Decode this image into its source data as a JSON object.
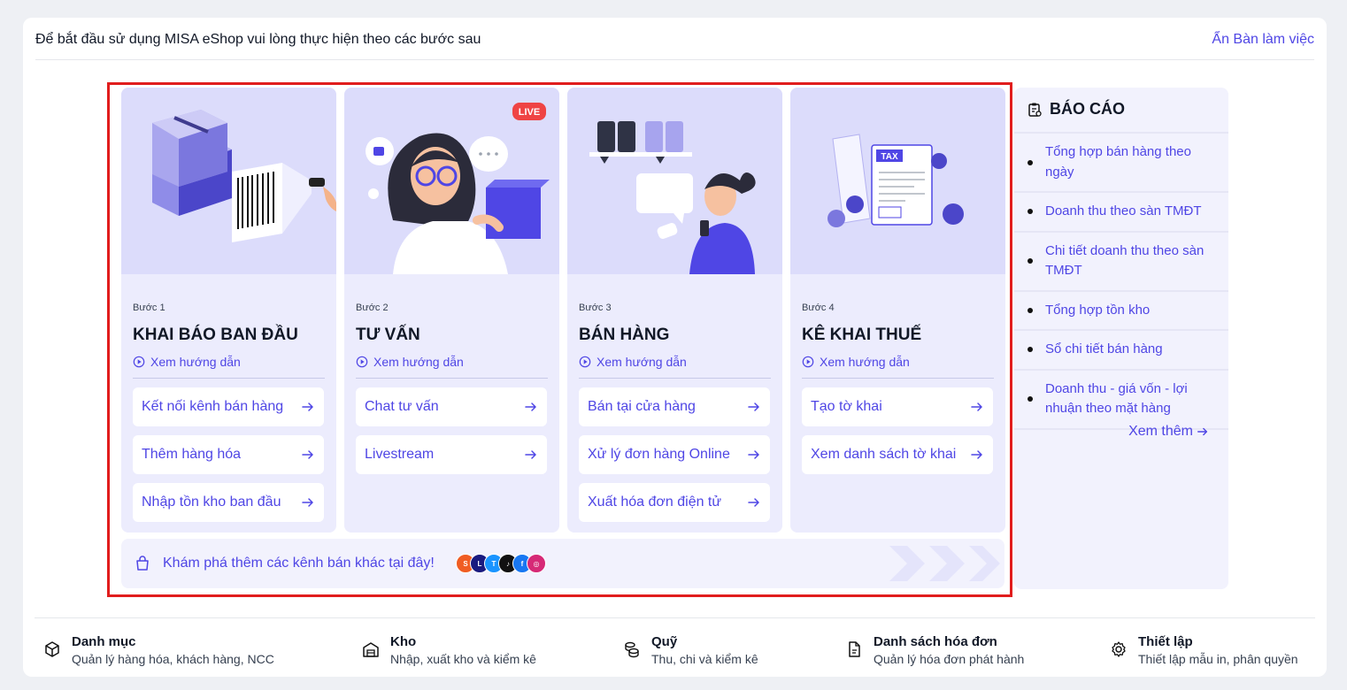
{
  "header": {
    "intro": "Để bắt đầu sử dụng MISA eShop vui lòng thực hiện theo các bước sau",
    "hide_label": "Ẩn Bàn làm việc"
  },
  "steps": [
    {
      "step": "Bước 1",
      "title": "KHAI BÁO BAN ĐẦU",
      "guide": "Xem hướng dẫn",
      "actions": [
        "Kết nối kênh bán hàng",
        "Thêm hàng hóa",
        "Nhập tồn kho ban đầu"
      ]
    },
    {
      "step": "Bước 2",
      "title": "TƯ VẤN",
      "guide": "Xem hướng dẫn",
      "live_badge": "LIVE",
      "actions": [
        "Chat tư vấn",
        "Livestream"
      ]
    },
    {
      "step": "Bước 3",
      "title": "BÁN HÀNG",
      "guide": "Xem hướng dẫn",
      "actions": [
        "Bán tại cửa hàng",
        "Xử lý đơn hàng Online",
        "Xuất hóa đơn điện tử"
      ]
    },
    {
      "step": "Bước 4",
      "title": "KÊ KHAI THUẾ",
      "guide": "Xem hướng dẫn",
      "tax_label": "TAX",
      "actions": [
        "Tạo tờ khai",
        "Xem danh sách tờ khai"
      ]
    }
  ],
  "channels": {
    "text": "Khám phá thêm các kênh bán khác tại đây!",
    "logos": [
      {
        "name": "shopee-icon",
        "color": "#f05d23"
      },
      {
        "name": "lazada-icon",
        "color": "#1a1a80"
      },
      {
        "name": "tiki-icon",
        "color": "#1a94ff"
      },
      {
        "name": "tiktok-icon",
        "color": "#111111"
      },
      {
        "name": "facebook-icon",
        "color": "#1877f2"
      },
      {
        "name": "instagram-icon",
        "color": "#d62976"
      }
    ]
  },
  "report": {
    "title": "BÁO CÁO",
    "items": [
      "Tổng hợp bán hàng theo ngày",
      "Doanh thu theo sàn TMĐT",
      "Chi tiết doanh thu theo sàn TMĐT",
      "Tổng hợp tồn kho",
      "Sổ chi tiết bán hàng",
      "Doanh thu - giá vốn - lợi nhuận theo mặt hàng"
    ],
    "more": "Xem thêm"
  },
  "footer": [
    {
      "title": "Danh mục",
      "sub": "Quản lý hàng hóa, khách hàng, NCC",
      "icon": "box-icon"
    },
    {
      "title": "Kho",
      "sub": "Nhập, xuất kho và kiểm kê",
      "icon": "warehouse-icon"
    },
    {
      "title": "Quỹ",
      "sub": "Thu, chi và kiểm kê",
      "icon": "coins-icon"
    },
    {
      "title": "Danh sách hóa đơn",
      "sub": "Quản lý hóa đơn phát hành",
      "icon": "invoice-icon"
    },
    {
      "title": "Thiết lập",
      "sub": "Thiết lập mẫu in, phân quyền",
      "icon": "gear-icon"
    }
  ],
  "colors": {
    "accent": "#4f46e5",
    "card_bg": "#ececfd",
    "illustration_bg": "#dcdcfb",
    "highlight": "#e11d1d"
  }
}
